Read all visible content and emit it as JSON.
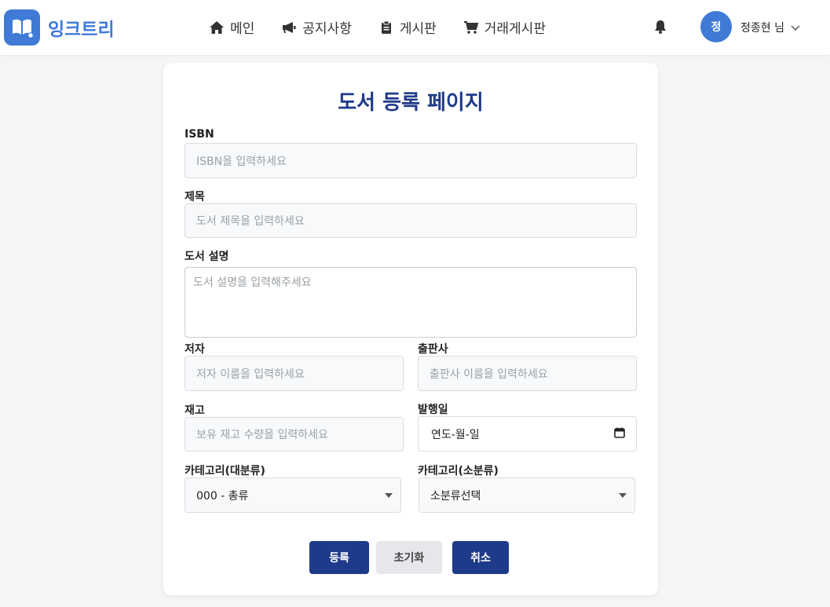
{
  "app": {
    "logo_text": "잉크트리"
  },
  "nav": {
    "items": [
      {
        "label": "메인",
        "icon": "home-icon"
      },
      {
        "label": "공지사항",
        "icon": "megaphone-icon"
      },
      {
        "label": "게시판",
        "icon": "clipboard-icon"
      },
      {
        "label": "거래게시판",
        "icon": "cart-icon"
      }
    ]
  },
  "user": {
    "avatar_initial": "정",
    "name": "정종현 님"
  },
  "form": {
    "title": "도서 등록 페이지",
    "isbn": {
      "label": "ISBN",
      "placeholder": "ISBN을 입력하세요"
    },
    "book_title": {
      "label": "제목",
      "placeholder": "도서 제목을 입력하세요"
    },
    "description": {
      "label": "도서 설명",
      "placeholder": "도서 설명을 입력해주세요"
    },
    "author": {
      "label": "저자",
      "placeholder": "저자 이름을 입력하세요"
    },
    "publisher": {
      "label": "출판사",
      "placeholder": "출판사 이름을 입력하세요"
    },
    "stock": {
      "label": "재고",
      "placeholder": "보유 재고 수량을 입력하세요"
    },
    "publish_date": {
      "label": "발행일",
      "value": "연도-월-일"
    },
    "category_main": {
      "label": "카테고리(대분류)",
      "selected": "000 - 총류"
    },
    "category_sub": {
      "label": "카테고리(소분류)",
      "selected": "소분류선택"
    },
    "buttons": {
      "submit": "등록",
      "reset": "초기화",
      "cancel": "취소"
    }
  },
  "colors": {
    "primary": "#1e3a8a",
    "brand": "#3f7bd6",
    "background": "#f4f5f7"
  }
}
